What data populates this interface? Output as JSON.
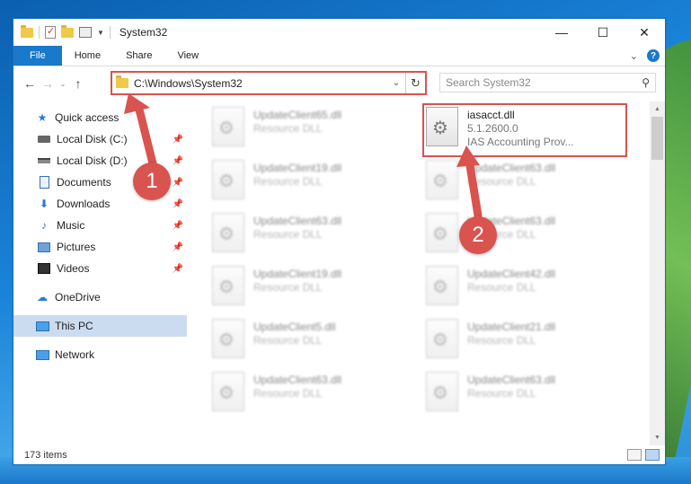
{
  "window": {
    "title": "System32",
    "minimize": "—",
    "maximize": "☐",
    "close": "✕"
  },
  "ribbon": {
    "tabs": [
      "File",
      "Home",
      "Share",
      "View"
    ]
  },
  "address": {
    "path": "C:\\Windows\\System32",
    "search_placeholder": "Search System32"
  },
  "nav": {
    "quick_access": "Quick access",
    "items": [
      {
        "label": "Local Disk (C:)",
        "icon": "disk-icon",
        "pinned": true
      },
      {
        "label": "Local Disk (D:)",
        "icon": "disk-icon",
        "pinned": true
      },
      {
        "label": "Documents",
        "icon": "documents-icon",
        "pinned": true
      },
      {
        "label": "Downloads",
        "icon": "downloads-icon",
        "pinned": true
      },
      {
        "label": "Music",
        "icon": "music-icon",
        "pinned": true
      },
      {
        "label": "Pictures",
        "icon": "pictures-icon",
        "pinned": true
      },
      {
        "label": "Videos",
        "icon": "videos-icon",
        "pinned": true
      }
    ],
    "onedrive": "OneDrive",
    "this_pc": "This PC",
    "network": "Network"
  },
  "files": {
    "left_column": [
      {
        "name": "UpdateClient65.dll",
        "type": "Resource DLL"
      },
      {
        "name": "UpdateClient19.dll",
        "type": "Resource DLL"
      },
      {
        "name": "UpdateClient63.dll",
        "type": "Resource DLL"
      },
      {
        "name": "UpdateClient19.dll",
        "type": "Resource DLL"
      },
      {
        "name": "UpdateClient5.dll",
        "type": "Resource DLL"
      },
      {
        "name": "UpdateClient63.dll",
        "type": "Resource DLL"
      }
    ],
    "right_column": [
      {
        "name": "UpdateClient63.dll",
        "type": "Resource DLL"
      },
      {
        "name": "UpdateClient63.dll",
        "type": "Resource DLL"
      },
      {
        "name": "UpdateClient42.dll",
        "type": "Resource DLL"
      },
      {
        "name": "UpdateClient21.dll",
        "type": "Resource DLL"
      },
      {
        "name": "UpdateClient63.dll",
        "type": "Resource DLL"
      }
    ],
    "selected": {
      "name": "iasacct.dll",
      "version": "5.1.2600.0",
      "description": "IAS Accounting Prov..."
    }
  },
  "status": {
    "item_count": "173 items"
  },
  "annotations": {
    "step1": "1",
    "step2": "2",
    "color": "#d9534f"
  }
}
